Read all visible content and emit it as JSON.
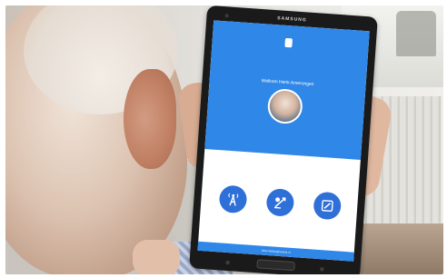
{
  "device": {
    "brand": "SAMSUNG"
  },
  "app": {
    "welcome_text": "Welkom Henk Amerongen",
    "footer_text": "help.melding@roobot.nl",
    "accent_color": "#2f87e8",
    "button_color": "#2f6fd8",
    "buttons": [
      {
        "icon": "antenna-icon"
      },
      {
        "icon": "pencil-note-icon"
      },
      {
        "icon": "edit-square-icon"
      }
    ]
  }
}
